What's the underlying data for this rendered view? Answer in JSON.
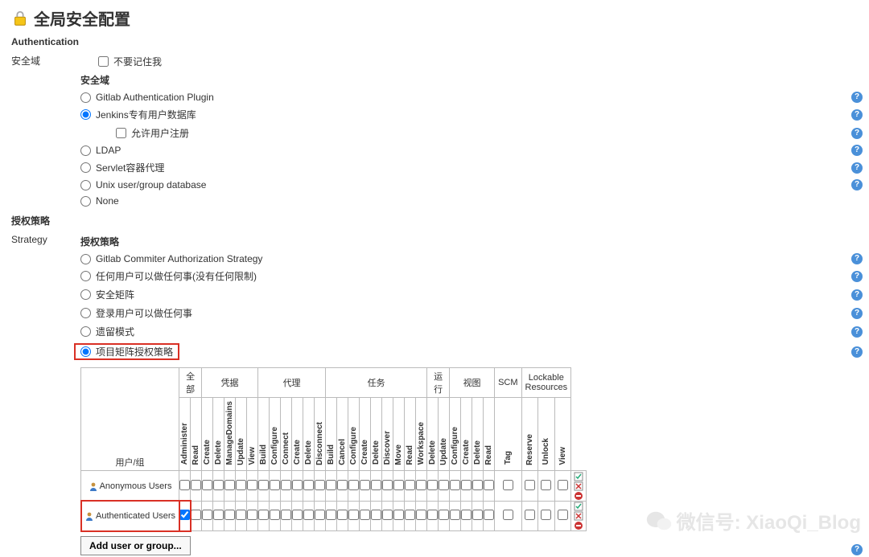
{
  "page": {
    "title": "全局安全配置"
  },
  "authSection": {
    "header": "Authentication",
    "realmLabel": "安全域",
    "rememberMe": "不要记住我",
    "realmHeader": "安全域",
    "realms": {
      "gitlab": "Gitlab Authentication Plugin",
      "jenkins": "Jenkins专有用户数据库",
      "allowSignup": "允许用户注册",
      "ldap": "LDAP",
      "servlet": "Servlet容器代理",
      "unix": "Unix user/group database",
      "none": "None"
    }
  },
  "authzSection": {
    "header": "授权策略",
    "strategyLabel": "Strategy",
    "strategyHeader": "授权策略",
    "strategies": {
      "gitlab": "Gitlab Commiter Authorization Strategy",
      "anyone": "任何用户可以做任何事(没有任何限制)",
      "matrix": "安全矩阵",
      "logged": "登录用户可以做任何事",
      "legacy": "遗留模式",
      "project": "项目矩阵授权策略"
    }
  },
  "matrix": {
    "userHeader": "用户/组",
    "groups": [
      "全部",
      "凭据",
      "代理",
      "任务",
      "运行",
      "视图",
      "SCM",
      "Lockable Resources"
    ],
    "perms": [
      "Administer",
      "Read",
      "Create",
      "Delete",
      "ManageDomains",
      "Update",
      "View",
      "Build",
      "Configure",
      "Connect",
      "Create",
      "Delete",
      "Disconnect",
      "Build",
      "Cancel",
      "Configure",
      "Create",
      "Delete",
      "Discover",
      "Move",
      "Read",
      "Workspace",
      "Delete",
      "Update",
      "Configure",
      "Create",
      "Delete",
      "Read",
      "Tag",
      "Reserve",
      "Unlock",
      "View"
    ],
    "groupSpans": [
      2,
      5,
      6,
      9,
      2,
      4,
      1,
      3
    ],
    "rows": [
      {
        "name": "Anonymous Users",
        "highlight": false,
        "first": false
      },
      {
        "name": "Authenticated Users",
        "highlight": true,
        "first": true
      }
    ],
    "addBtn": "Add user or group..."
  },
  "watermark": {
    "text": "微信号: XiaoQi_Blog"
  }
}
